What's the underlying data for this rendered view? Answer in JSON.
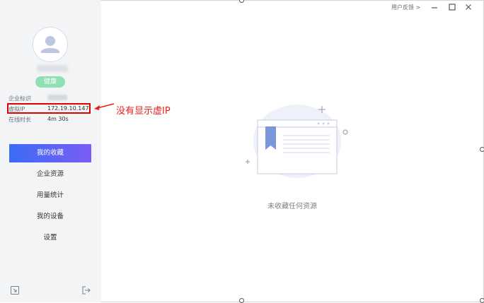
{
  "profile": {
    "status_badge": "健康"
  },
  "info": {
    "company_label": "企业标识",
    "vip_label": "虚拟IP",
    "vip_value": "172.19.10.147",
    "online_label": "在线时长",
    "online_value": "4m 30s"
  },
  "nav": [
    {
      "label": "我的收藏",
      "active": true
    },
    {
      "label": "企业资源",
      "active": false
    },
    {
      "label": "用量统计",
      "active": false
    },
    {
      "label": "我的设备",
      "active": false
    },
    {
      "label": "设置",
      "active": false
    }
  ],
  "annotation": {
    "text": "没有显示虚IP"
  },
  "titlebar": {
    "feedback": "用户反馈 >"
  },
  "main": {
    "empty_text": "未收藏任何资源"
  },
  "colors": {
    "accent_start": "#3b6cf4",
    "accent_end": "#7a5cf6",
    "health_green": "#8fe0b3",
    "annotation_red": "#e00000"
  }
}
